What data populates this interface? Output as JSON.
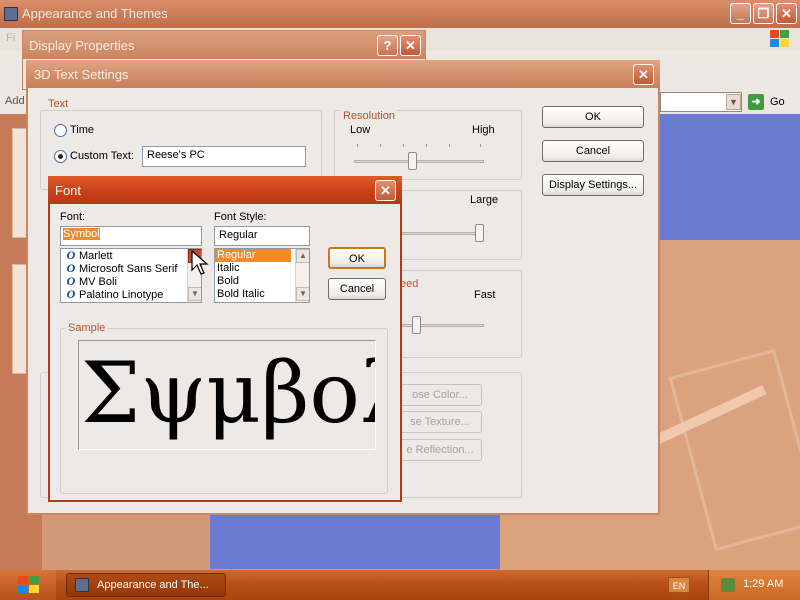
{
  "explorer": {
    "title": "Appearance and Themes",
    "menu_partial": "Fi",
    "address_label": "Add",
    "go_label": "Go"
  },
  "display_properties": {
    "title": "Display Properties"
  },
  "text_settings": {
    "title": "3D Text Settings",
    "text_group": "Text",
    "time_label": "Time",
    "custom_text_label": "Custom Text:",
    "custom_text_value": "Reese's PC",
    "resolution_group": "Resolution",
    "resolution_low": "Low",
    "resolution_high": "High",
    "size_large": "Large",
    "speed_group_partial": "eed",
    "speed_fast": "Fast",
    "choose_color_partial": "ose Color...",
    "choose_texture_partial": "se Texture...",
    "reflection_partial": "e Reflection...",
    "ok": "OK",
    "cancel": "Cancel",
    "display_settings": "Display Settings..."
  },
  "font_dialog": {
    "title": "Font",
    "font_label": "Font:",
    "font_value": "Symbol",
    "font_list": [
      "Marlett",
      "Microsoft Sans Serif",
      "MV Boli",
      "Palatino Linotype"
    ],
    "style_label": "Font Style:",
    "style_value": "Regular",
    "style_list": [
      "Regular",
      "Italic",
      "Bold",
      "Bold Italic"
    ],
    "selected_style": "Regular",
    "ok": "OK",
    "cancel": "Cancel",
    "sample_group": "Sample",
    "sample_text": "Σψμβολ"
  },
  "taskbar": {
    "task_label": "Appearance and The...",
    "language": "EN",
    "clock": "1:29 AM"
  },
  "colors": {
    "title_active": "#c8401a",
    "title_inactive": "#d28c67",
    "group_label": "#b2542e",
    "selection": "#f08a2a"
  }
}
